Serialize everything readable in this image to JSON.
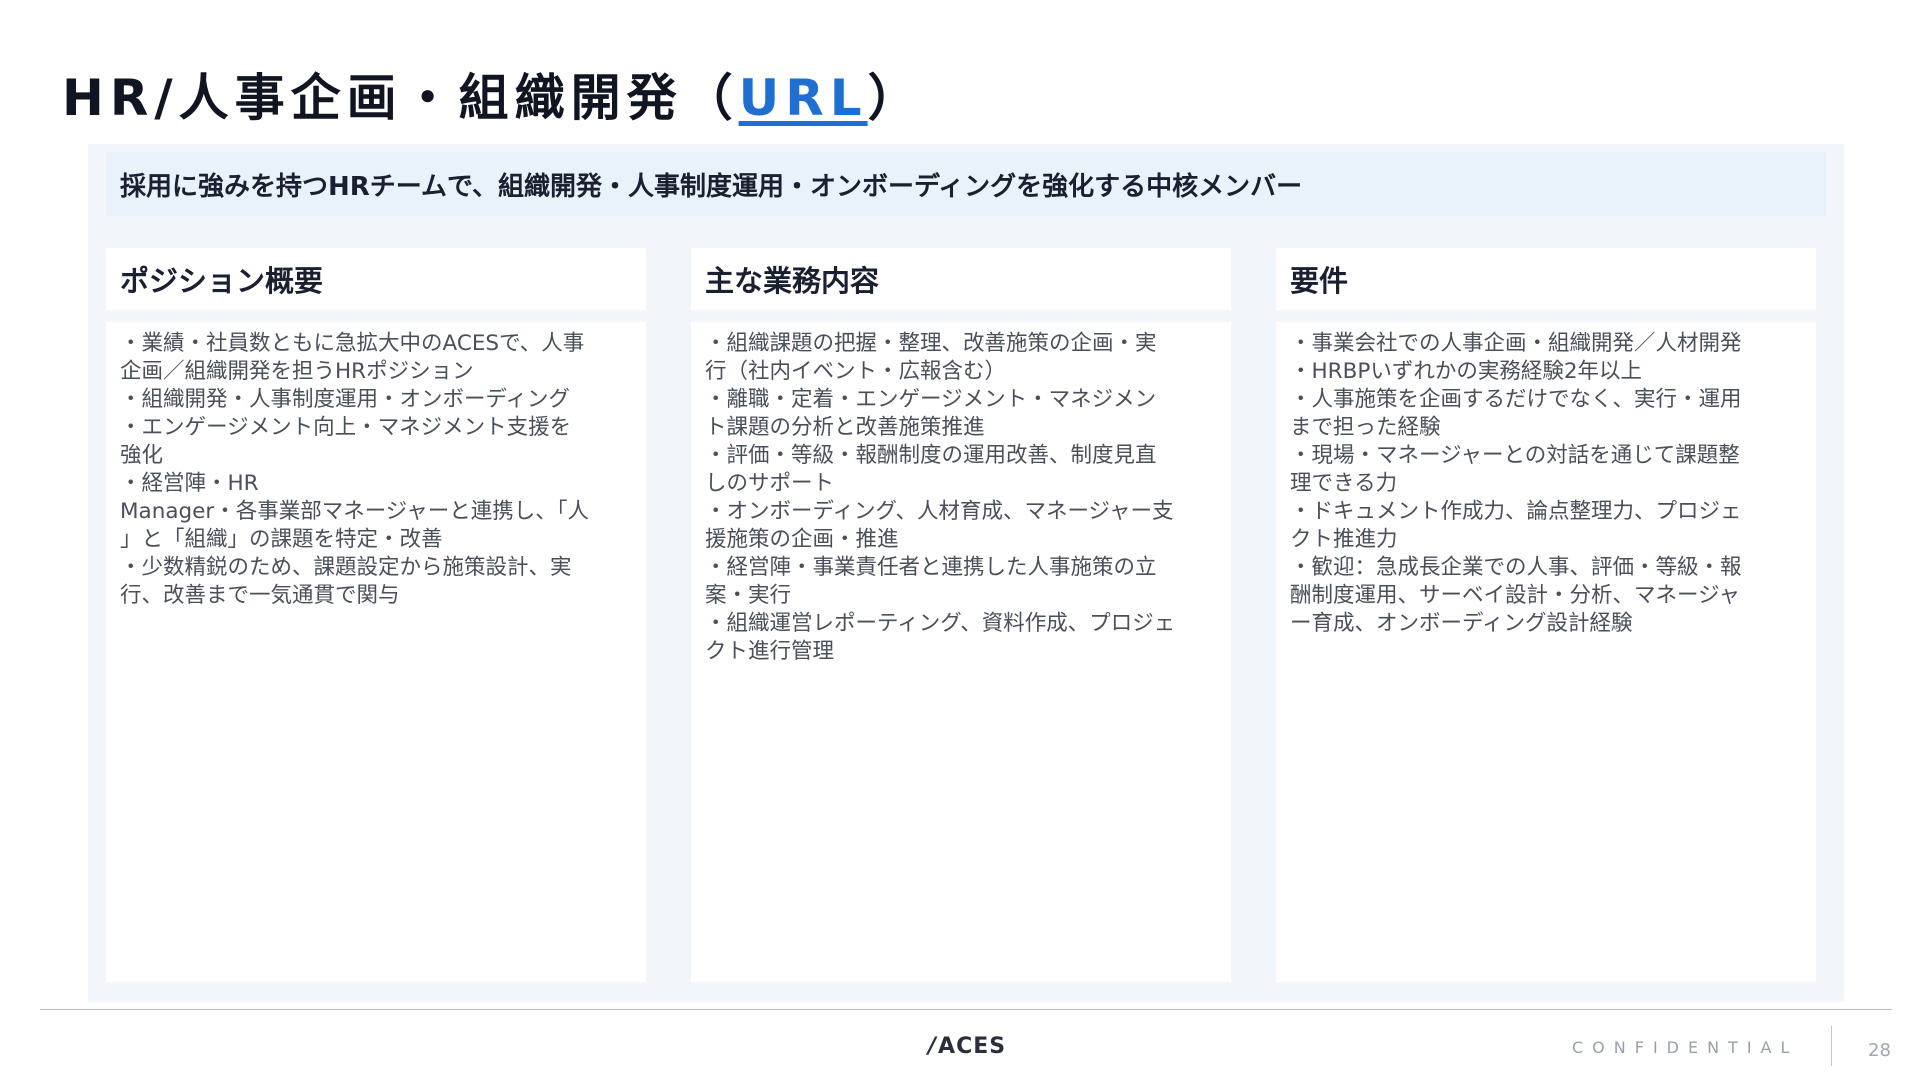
{
  "title": {
    "main": "HR/人事企画・組織開発（",
    "link": "URL",
    "close": "）"
  },
  "lead": "採用に強みを持つHRチームで、組織開発・人事制度運用・オンボーディングを強化する中核メンバー",
  "columns": [
    {
      "heading": "ポジション概要",
      "lines": [
        "・業績・社員数ともに急拡大中のACESで、人事",
        "企画／組織開発を担うHRポジション",
        "・組織開発・人事制度運用・オンボーディング",
        "・エンゲージメント向上・マネジメント支援を",
        "強化",
        "・経営陣・HR",
        "Manager・各事業部マネージャーと連携し、「人",
        "」と「組織」の課題を特定・改善",
        "・少数精鋭のため、課題設定から施策設計、実",
        "行、改善まで一気通貫で関与"
      ]
    },
    {
      "heading": "主な業務内容",
      "lines": [
        "・組織課題の把握・整理、改善施策の企画・実",
        "行（社内イベント・広報含む）",
        "・離職・定着・エンゲージメント・マネジメン",
        "ト課題の分析と改善施策推進",
        "・評価・等級・報酬制度の運用改善、制度見直",
        "しのサポート",
        "・オンボーディング、人材育成、マネージャー支",
        "援施策の企画・推進",
        "・経営陣・事業責任者と連携した人事施策の立",
        "案・実行",
        "・組織運営レポーティング、資料作成、プロジェ",
        "クト進行管理"
      ]
    },
    {
      "heading": "要件",
      "lines": [
        "・事業会社での人事企画・組織開発／人材開発",
        "・HRBPいずれかの実務経験2年以上",
        "・人事施策を企画するだけでなく、実行・運用",
        "まで担った経験",
        "・現場・マネージャーとの対話を通じて課題整",
        "理できる力",
        "・ドキュメント作成力、論点整理力、プロジェ",
        "クト推進力",
        "・歓迎：急成長企業での人事、評価・等級・報",
        "酬制度運用、サーベイ設計・分析、マネージャ",
        "ー育成、オンボーディング設計経験"
      ]
    }
  ],
  "footer": {
    "logo": "ACES",
    "confidential": "CONFIDENTIAL",
    "page": "28"
  }
}
